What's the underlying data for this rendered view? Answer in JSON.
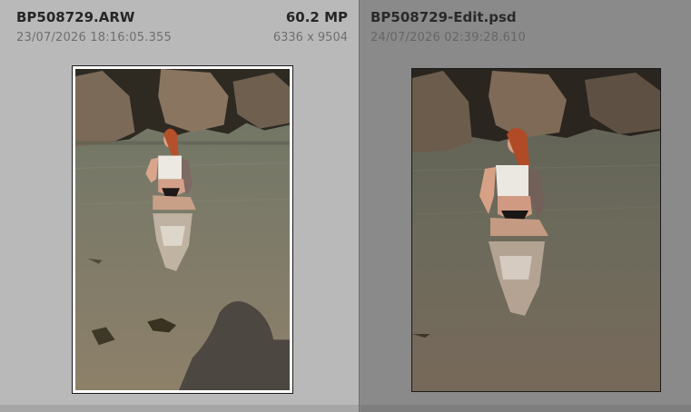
{
  "left_panel": {
    "filename": "BP508729.ARW",
    "datetime": "23/07/2026 18:16:05.355",
    "megapixels": "60.2 MP",
    "dimensions": "6336 x 9504",
    "photo_icon": "photo-thumbnail"
  },
  "right_panel": {
    "filename": "BP508729-Edit.psd",
    "datetime": "24/07/2026 02:39:28.610",
    "photo_icon": "photo-thumbnail"
  },
  "colors": {
    "left_bg": "#b9b9b9",
    "right_bg": "#8a8a8a",
    "selected_frame": "#ffffff"
  }
}
